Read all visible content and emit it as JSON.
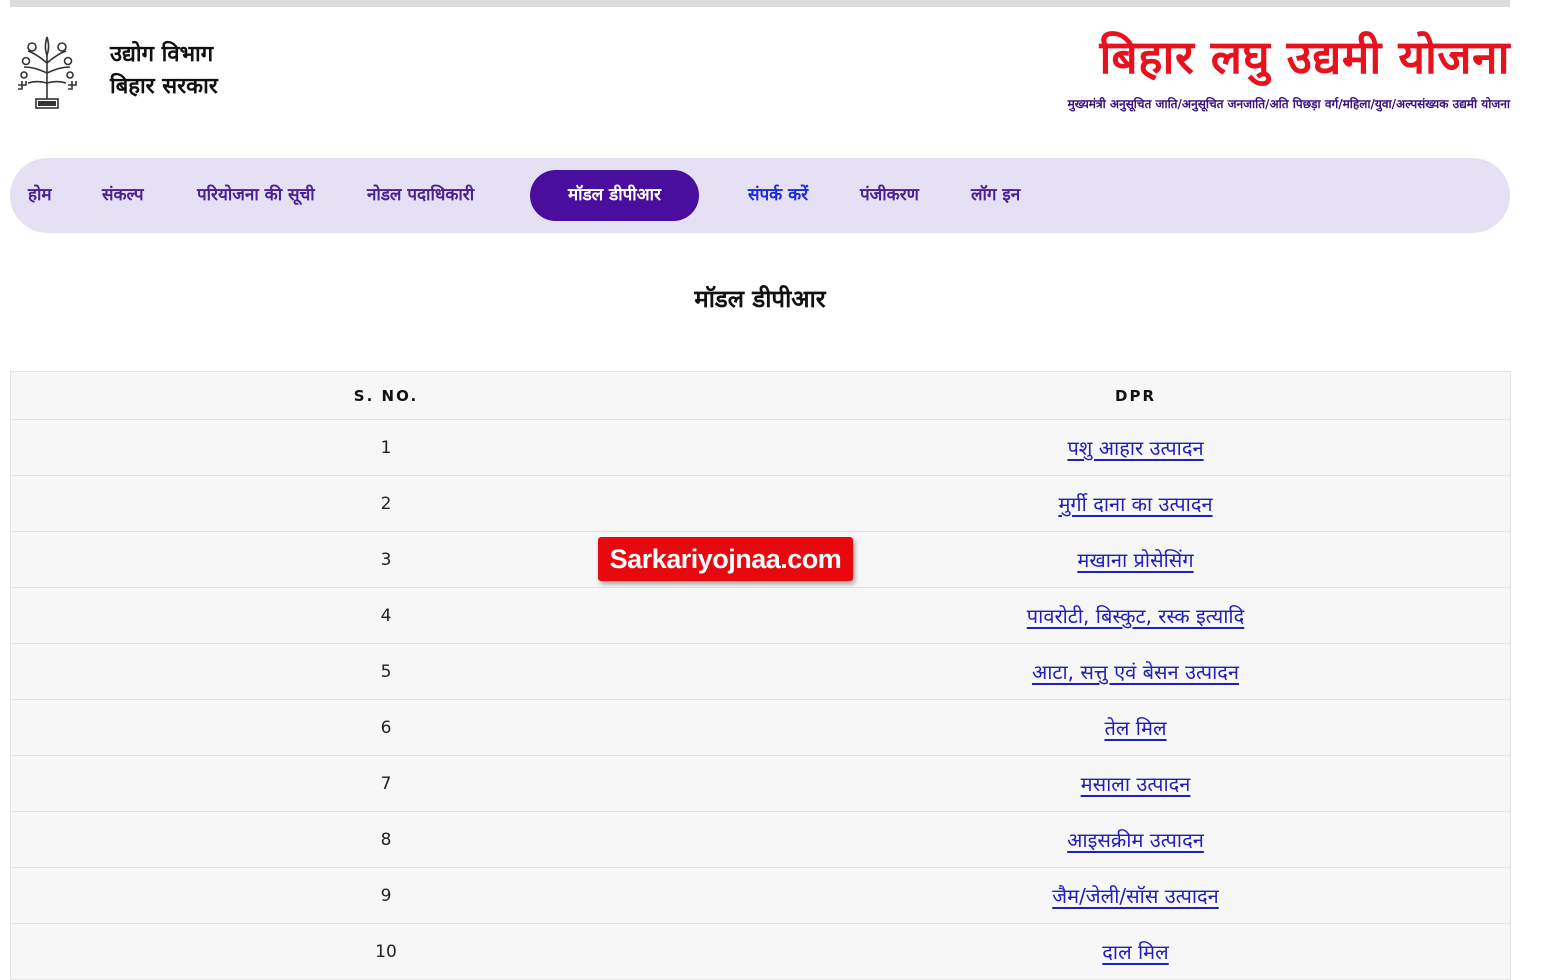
{
  "header": {
    "dept_line1": "उद्योग विभाग",
    "dept_line2": "बिहार सरकार",
    "brand_title": "बिहार लघु उद्यमी योजना",
    "brand_subtitle": "मुख्यमंत्री अनुसूचित जाति/अनुसूचित जनजाति/अति पिछड़ा वर्ग/महिला/युवा/अल्पसंख्यक उद्यमी योजना"
  },
  "nav": {
    "items": [
      {
        "label": "होम"
      },
      {
        "label": "संकल्प"
      },
      {
        "label": "परियोजना की सूची"
      },
      {
        "label": "नोडल पदाधिकारी"
      },
      {
        "label": "मॉडल डीपीआर",
        "active": true
      },
      {
        "label": "संपर्क करें"
      },
      {
        "label": "पंजीकरण"
      },
      {
        "label": "लॉग इन"
      }
    ]
  },
  "main": {
    "title": "मॉडल डीपीआर",
    "table": {
      "headers": [
        "S. NO.",
        "DPR"
      ],
      "rows": [
        {
          "sno": "1",
          "dpr": "पशु आहार उत्पादन"
        },
        {
          "sno": "2",
          "dpr": "मुर्गी दाना का उत्पादन"
        },
        {
          "sno": "3",
          "dpr": "मखाना प्रोसेसिंग"
        },
        {
          "sno": "4",
          "dpr": "पावरोटी, बिस्कुट, रस्क इत्यादि"
        },
        {
          "sno": "5",
          "dpr": "आटा, सत्तु एवं बेसन उत्पादन"
        },
        {
          "sno": "6",
          "dpr": "तेल मिल"
        },
        {
          "sno": "7",
          "dpr": "मसाला उत्पादन"
        },
        {
          "sno": "8",
          "dpr": "आइसक्रीम उत्पादन"
        },
        {
          "sno": "9",
          "dpr": "जैम/जेली/सॉस उत्पादन"
        },
        {
          "sno": "10",
          "dpr": "दाल मिल"
        }
      ]
    }
  },
  "watermark": "Sarkariyojnaa.com",
  "colors": {
    "brand_red": "#e8121e",
    "nav_bg": "#e6e0f5",
    "nav_active_bg": "#4a0e9e",
    "nav_text": "#4b2191",
    "link": "#2020b8"
  }
}
